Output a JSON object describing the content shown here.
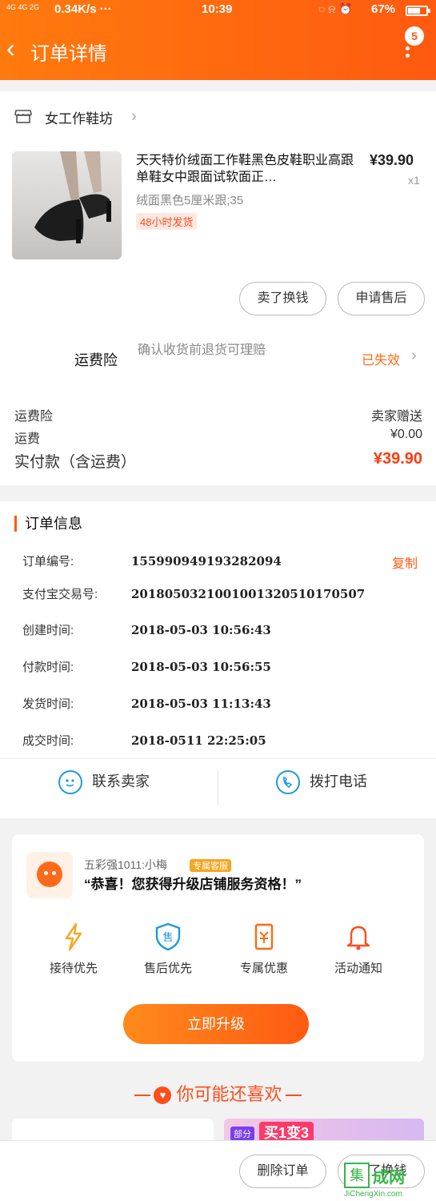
{
  "status_bar": {
    "network": "4G 4G 2G",
    "speed": "0.34K/s ···",
    "time": "10:39",
    "icons": "◌ ⍾ ⏰",
    "battery_pct": "67%",
    "battery_level": 0.67
  },
  "header": {
    "back_icon": "chevron-left-icon",
    "title": "订单详情",
    "badge": "5",
    "more_icon": "more-vertical-icon",
    "accent": "#ff5a10"
  },
  "shop": {
    "name": "女工作鞋坊",
    "arrow": "›"
  },
  "product": {
    "title": "天天特价绒面工作鞋黑色皮鞋职业高跟单鞋女中跟面试软面正…",
    "price": "¥39.90",
    "qty": "x1",
    "sku": "绒面黑色5厘米跟;35",
    "ship_tag": "48小时发货"
  },
  "actions": {
    "sell_label": "卖了换钱",
    "after_sale_label": "申请售后"
  },
  "insurance": {
    "label": "运费险",
    "desc": "确认收货前退货可理赔",
    "status": "已失效",
    "arrow": "›"
  },
  "fees": {
    "rows": [
      {
        "label": "运费险",
        "value": "卖家赠送"
      },
      {
        "label": "运费",
        "value": "¥0.00"
      }
    ],
    "total_label": "实付款（含运费）",
    "total_value": "¥39.90"
  },
  "order_info": {
    "title": "订单信息",
    "copy_label": "复制",
    "rows": [
      {
        "key": "订单编号:",
        "value": "155990949193282094"
      },
      {
        "key": "支付宝交易号:",
        "value": "2018050321001001320510170507"
      },
      {
        "key": "创建时间:",
        "value": "2018-05-03 10:56:43"
      },
      {
        "key": "付款时间:",
        "value": "2018-05-03 10:56:55"
      },
      {
        "key": "发货时间:",
        "value": "2018-05-03 11:13:43"
      },
      {
        "key": "成交时间:",
        "value": "2018-0511 22:25:05"
      }
    ]
  },
  "contact": {
    "seller_label": "联系卖家",
    "call_label": "拨打电话",
    "icon_color": "#1e9bd7"
  },
  "promo": {
    "from": "五彩强1011:小梅",
    "tag": "专属客服",
    "message": "“恭喜！您获得升级店铺服务资格！”",
    "perks": [
      {
        "icon": "lightning-icon",
        "label": "接待优先",
        "color": "#f5a623"
      },
      {
        "icon": "shield-icon",
        "label": "售后优先",
        "color": "#1e9bd7"
      },
      {
        "icon": "ticket-icon",
        "label": "专属优惠",
        "color": "#ff6a10"
      },
      {
        "icon": "bell-icon",
        "label": "活动通知",
        "color": "#ff4d1c"
      }
    ],
    "button": "立即升级"
  },
  "guess": {
    "title": "你可能还喜欢"
  },
  "recommend": {
    "right_tag": "部分",
    "right_big": "买1变3"
  },
  "bottom": {
    "delete_label": "删除订单",
    "sell_label": "卖了换钱"
  },
  "watermark": {
    "mark": "集",
    "name": "成网",
    "url": "JiChengXin.com"
  }
}
